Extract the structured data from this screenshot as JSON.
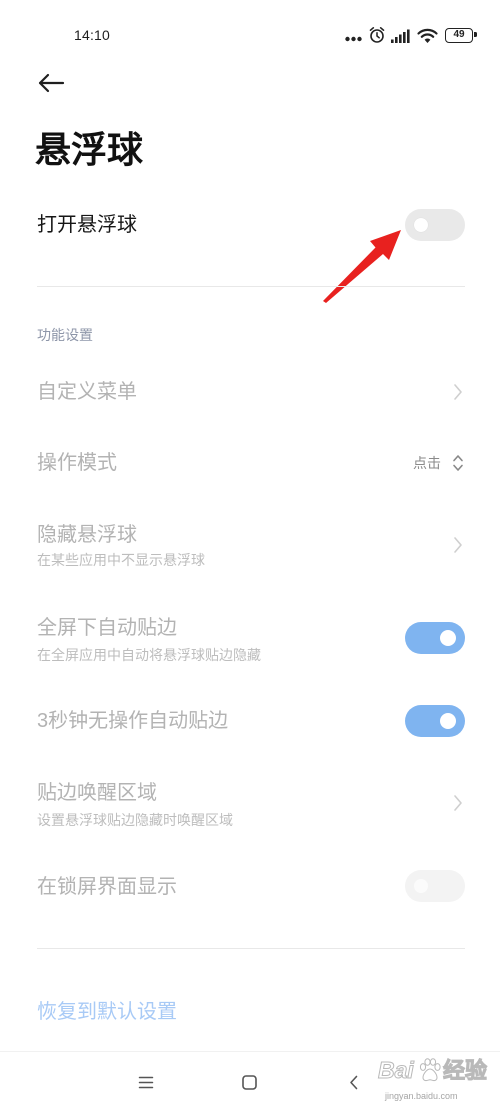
{
  "status_bar": {
    "time": "14:10",
    "battery_level": "49",
    "icons": [
      "more-dots-icon",
      "alarm-icon",
      "signal-icon",
      "wifi-icon",
      "battery-icon"
    ]
  },
  "header": {
    "back_icon": "back-arrow-icon",
    "title": "悬浮球"
  },
  "master_switch": {
    "label": "打开悬浮球",
    "toggle_on": false
  },
  "feature_section": {
    "title": "功能设置",
    "disabled": true,
    "items": [
      {
        "title": "自定义菜单",
        "chevron_icon": "chevron-right-icon"
      },
      {
        "title": "操作模式",
        "value": "点击",
        "value_icon": "up-down-chevron-icon"
      },
      {
        "title": "隐藏悬浮球",
        "subtitle": "在某些应用中不显示悬浮球",
        "chevron_icon": "chevron-right-icon"
      },
      {
        "title": "全屏下自动贴边",
        "subtitle": "在全屏应用中自动将悬浮球贴边隐藏",
        "toggle_on": true
      },
      {
        "title": "3秒钟无操作自动贴边",
        "toggle_on": true
      },
      {
        "title": "贴边唤醒区域",
        "subtitle": "设置悬浮球贴边隐藏时唤醒区域",
        "chevron_icon": "chevron-right-icon"
      },
      {
        "title": "在锁屏界面显示",
        "toggle_on": false
      }
    ]
  },
  "reset": {
    "label": "恢复到默认设置"
  },
  "nav_bar": {
    "icons": [
      "menu-icon",
      "home-icon",
      "back-icon"
    ]
  },
  "annotation": {
    "icon": "red-arrow-icon"
  },
  "watermark": {
    "logo_text": "Bai",
    "logo_icon": "baidu-paw-icon",
    "logo_suffix": "经验",
    "site": "jingyan.baidu.com"
  },
  "colors": {
    "toggle_on": "#7fb4f0",
    "section_header": "#8e96a9",
    "reset_link": "#a8caf6",
    "annotation_arrow": "#e8211f",
    "disabled_text": "#b3b3b3"
  }
}
